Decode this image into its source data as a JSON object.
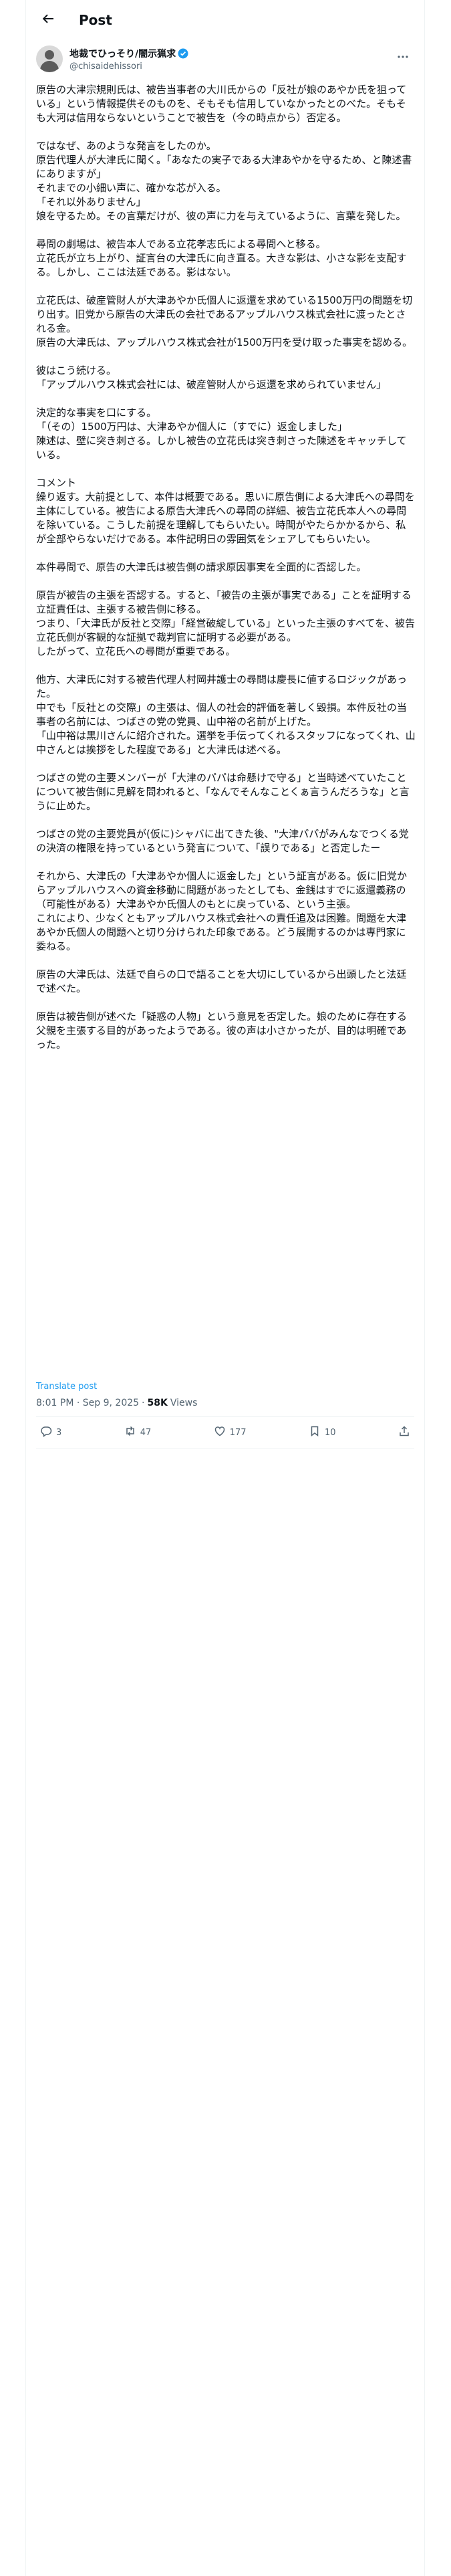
{
  "header": {
    "title": "Post",
    "back_icon": "arrow-left-icon"
  },
  "author": {
    "display_name": "地裁でひっそり/闇示猟求",
    "handle": "@chisaidehissori",
    "verified": true,
    "verified_color": "#1d9bf0"
  },
  "post": {
    "body": "原告の大津宗規則氏は、被告当事者の大川氏からの「反社が娘のあやか氏を狙っている」という情報提供そのものを、そもそも信用していなかったとのべた。そもそも大河は信用ならないということで被告を（今の時点から）否定る。\n\nではなぜ、あのような発言をしたのか。\n原告代理人が大津氏に聞く。「あなたの実子である大津あやかを守るため、と陳述書にありますが」\nそれまでの小細い声に、確かな芯が入る。\n「それ以外ありません」\n娘を守るため。その言葉だけが、彼の声に力を与えているように、言葉を発した。\n\n尋問の劇場は、被告本人である立花孝志氏による尋問へと移る。\n立花氏が立ち上がり、証言台の大津氏に向き直る。大きな影は、小さな影を支配する。しかし、ここは法廷である。影はない。\n\n立花氏は、破産管財人が大津あやか氏個人に返還を求めている1500万円の問題を切り出す。旧党から原告の大津氏の会社であるアップルハウス株式会社に渡ったとされる金。\n原告の大津氏は、アップルハウス株式会社が1500万円を受け取った事実を認める。\n\n彼はこう続ける。\n「アップルハウス株式会社には、破産管財人から返還を求められていません」\n\n決定的な事実を口にする。\n「（その）1500万円は、大津あやか個人に（すでに）返金しました」\n陳述は、壁に突き刺さる。しかし被告の立花氏は突き刺さった陳述をキャッチしている。\n\nコメント\n繰り返す。大前提として、本件は概要である。思いに原告側による大津氏への尋問を主体にしている。被告による原告大津氏への尋問の詳細、被告立花氏本人への尋問を除いている。こうした前提を理解してもらいたい。時間がやたらかかるから、私が全部やらないだけである。本件記明日の雰囲気をシェアしてもらいたい。\n\n本件尋問で、原告の大津氏は被告側の請求原因事実を全面的に否認した。\n\n原告が被告の主張を否認する。すると、「被告の主張が事実である」ことを証明する立証責任は、主張する被告側に移る。\nつまり、「大津氏が反社と交際」「経営破綻している」といった主張のすべてを、被告立花氏側が客観的な証拠で裁判官に証明する必要がある。\nしたがって、立花氏への尋問が重要である。\n\n他方、大津氏に対する被告代理人村岡井護士の尋問は慶長に値するロジックがあった。\n中でも「反社との交際」の主張は、個人の社会的評価を著しく毀損。本件反社の当事者の名前には、つばさの党の党員、山中裕の名前が上げた。\n「山中裕は黒川さんに紹介された。選挙を手伝ってくれるスタッフになってくれ、山中さんとは挨拶をした程度である」と大津氏は述べる。\n\nつばさの党の主要メンバーが「大津のパパは命懸けで守る」と当時述べていたことについて被告側に見解を問われると、「なんでそんなことくぁ言うんだろうな」と言うに止めた。\n\nつばさの党の主要党員が(仮に)シャバに出てきた後、\"大津パパがみんなでつくる党の決済の権限を持っているという発言について、「誤りである」と否定したー\n\nそれから、大津氏の「大津あやか個人に返金した」という証言がある。仮に旧党からアップルハウスへの資金移動に問題があったとしても、金銭はすでに返還義務の（可能性がある）大津あやか氏個人のもとに戻っている、という主張。\nこれにより、少なくともアップルハウス株式会社への責任追及は困難。問題を大津あやか氏個人の問題へと切り分けられた印象である。どう展開するのかは専門家に委ねる。\n\n原告の大津氏は、法廷で自らの口で語ることを大切にしているから出頭したと法廷で述べた。\n\n原告は被告側が述べた「疑惑の人物」という意見を否定した。娘のために存在する父親を主張する目的があったようである。彼の声は小さかったが、目的は明確であった。"
  },
  "translate_label": "Translate post",
  "meta": {
    "time": "8:01 PM · Sep 9, 2025",
    "separator": "·",
    "views_count": "58K",
    "views_label": "Views"
  },
  "actions": {
    "replies": "3",
    "reposts": "47",
    "likes": "177",
    "bookmarks": "10"
  },
  "colors": {
    "accent": "#1d9bf0",
    "secondary_text": "#536471",
    "border": "#eff3f4"
  }
}
